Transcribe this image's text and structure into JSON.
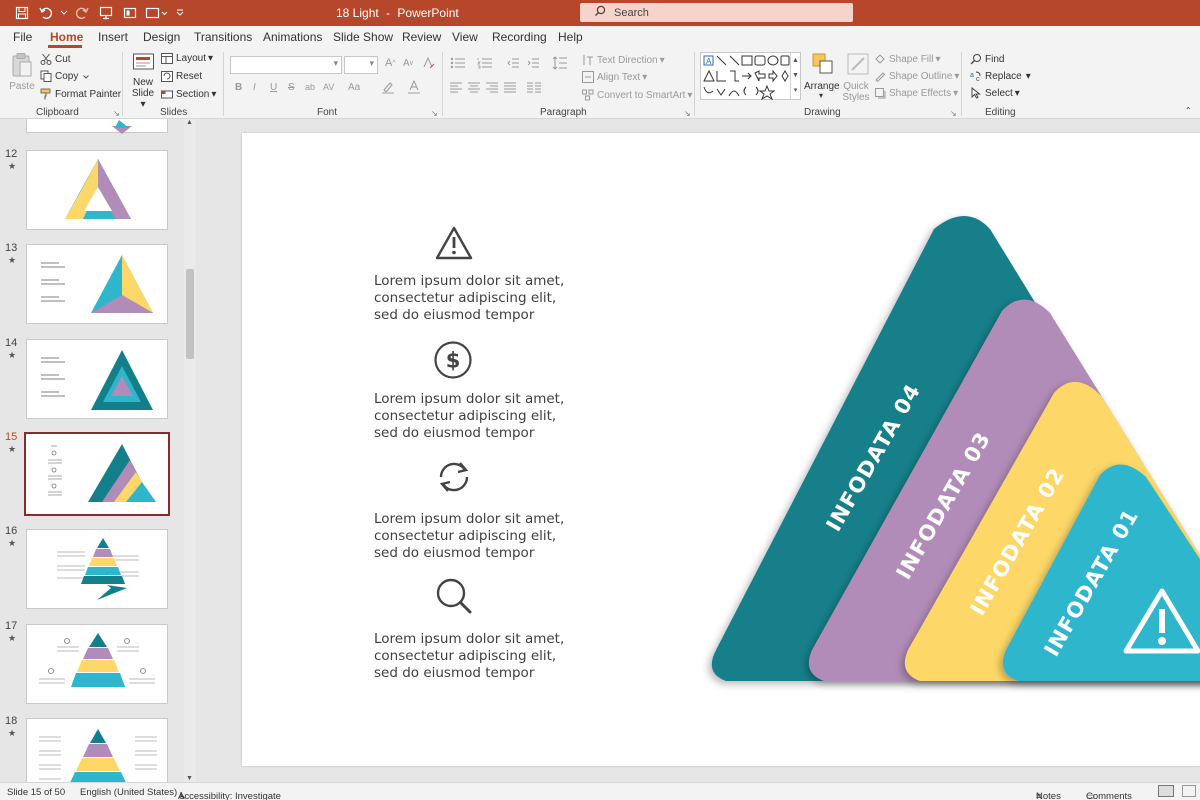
{
  "titlebar": {
    "doc_name": "18 Light",
    "separator": "-",
    "app_name": "PowerPoint",
    "search_placeholder": "Search"
  },
  "menu": {
    "tabs": [
      "File",
      "Home",
      "Insert",
      "Design",
      "Transitions",
      "Animations",
      "Slide Show",
      "Review",
      "View",
      "Recording",
      "Help"
    ],
    "active": "Home"
  },
  "ribbon": {
    "clipboard": {
      "label": "Clipboard",
      "paste": "Paste",
      "cut": "Cut",
      "copy": "Copy",
      "format_painter": "Format Painter"
    },
    "slides": {
      "label": "Slides",
      "new_slide_1": "New",
      "new_slide_2": "Slide",
      "layout": "Layout",
      "reset": "Reset",
      "section": "Section"
    },
    "font": {
      "label": "Font",
      "bold": "B",
      "italic": "I",
      "underline": "U",
      "strike": "S",
      "shadow": "ab",
      "aa": "Aa"
    },
    "paragraph": {
      "label": "Paragraph",
      "text_direction": "Text Direction",
      "align_text": "Align Text",
      "smartart": "Convert to SmartArt"
    },
    "drawing": {
      "label": "Drawing",
      "arrange": "Arrange",
      "quick_styles_1": "Quick",
      "quick_styles_2": "Styles",
      "shape_fill": "Shape Fill",
      "shape_outline": "Shape Outline",
      "shape_effects": "Shape Effects"
    },
    "editing": {
      "label": "Editing",
      "find": "Find",
      "replace": "Replace",
      "select": "Select"
    }
  },
  "thumbnails": [
    {
      "num": "12"
    },
    {
      "num": "13"
    },
    {
      "num": "14"
    },
    {
      "num": "15",
      "active": true
    },
    {
      "num": "16"
    },
    {
      "num": "17"
    },
    {
      "num": "18"
    }
  ],
  "thumb_star": "★",
  "slide": {
    "items": [
      {
        "icon": "warning-icon",
        "line1": "Lorem ipsum dolor sit amet,",
        "line2": "consectetur adipiscing elit,",
        "line3": "sed do eiusmod tempor"
      },
      {
        "icon": "dollar-icon",
        "line1": "Lorem ipsum dolor sit amet,",
        "line2": "consectetur adipiscing elit,",
        "line3": "sed do eiusmod tempor"
      },
      {
        "icon": "refresh-icon",
        "line1": "Lorem ipsum dolor sit amet,",
        "line2": "consectetur adipiscing elit,",
        "line3": "sed do eiusmod tempor"
      },
      {
        "icon": "search-icon",
        "line1": "Lorem ipsum dolor sit amet,",
        "line2": "consectetur adipiscing elit,",
        "line3": "sed do eiusmod tempor"
      }
    ],
    "pyramid": {
      "labels": [
        "INFODATA 04",
        "INFODATA 03",
        "INFODATA 02",
        "INFODATA 01"
      ],
      "colors": [
        "#137f8a",
        "#b18cb8",
        "#fdd868",
        "#2eb6cc"
      ]
    }
  },
  "status": {
    "slide_info": "Slide 15 of 50",
    "language": "English (United States)",
    "accessibility": "Accessibility: Investigate",
    "notes": "Notes",
    "comments": "Comments"
  },
  "colors": {
    "accent": "#b7472a"
  }
}
